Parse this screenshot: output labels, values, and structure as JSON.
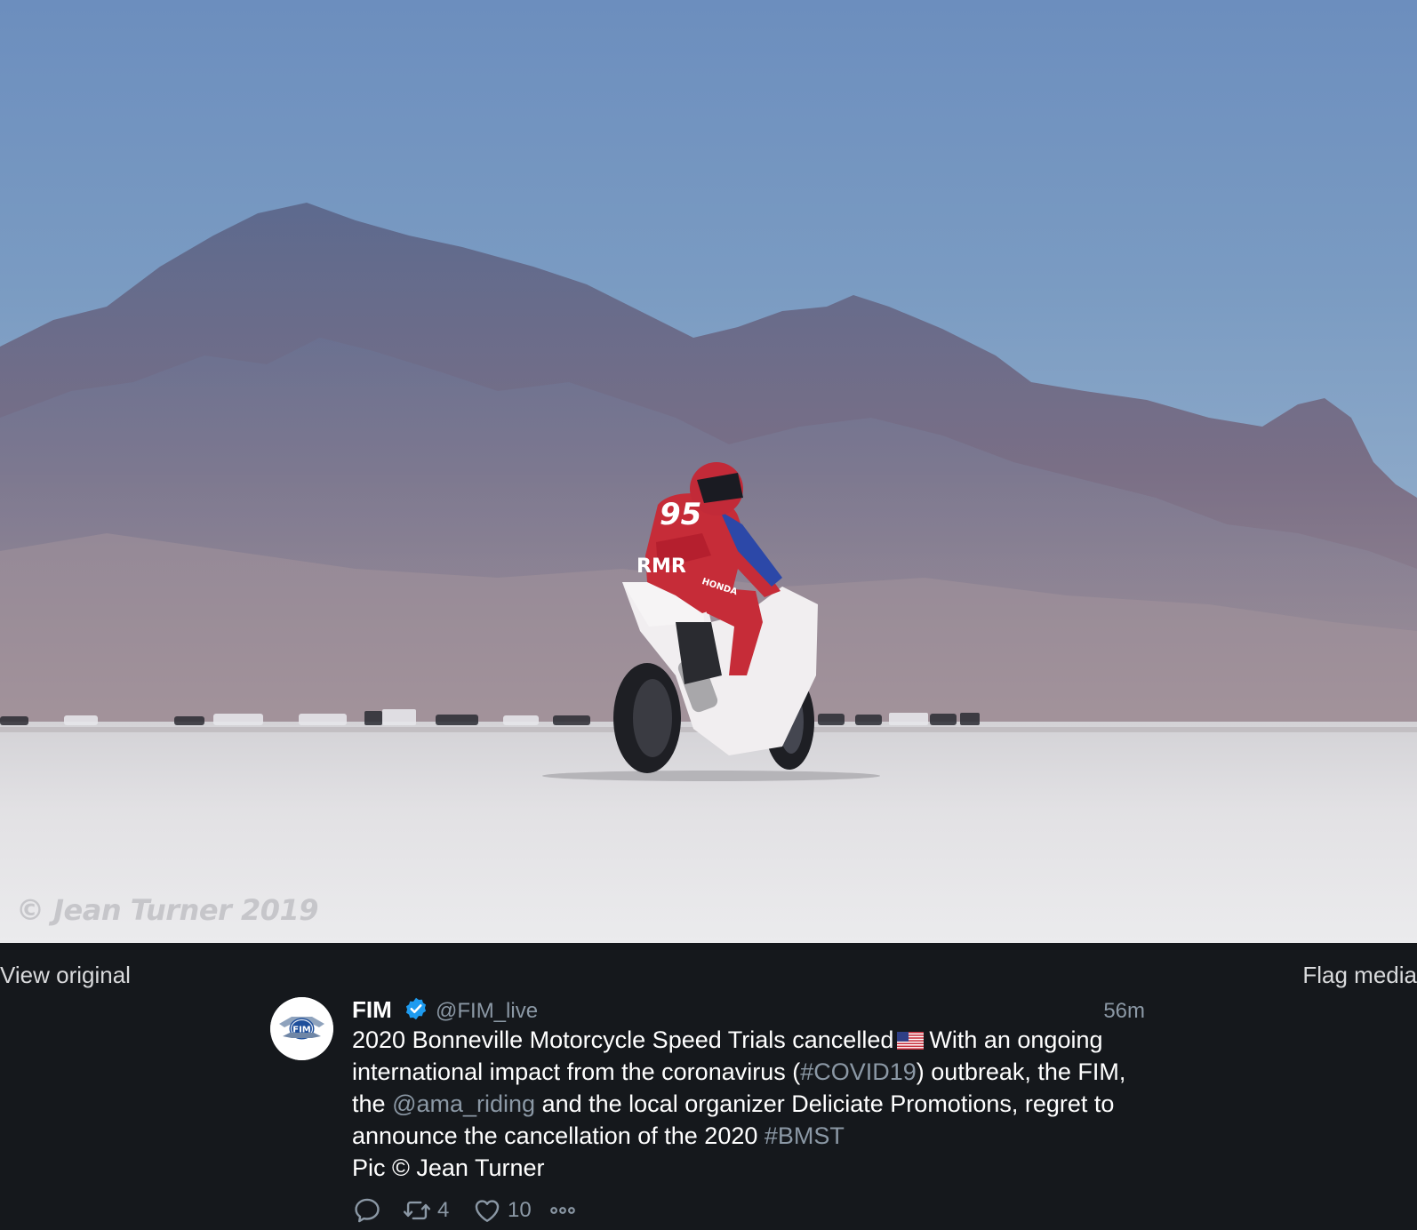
{
  "media": {
    "watermark": "© Jean Turner 2019",
    "rider_number": "95",
    "rider_badge": "RMR",
    "team_logo": "HONDA"
  },
  "viewer": {
    "view_original_label": "View original",
    "flag_media_label": "Flag media"
  },
  "tweet": {
    "author_name": "FIM",
    "author_handle": "@FIM_live",
    "timestamp": "56m",
    "avatar_text": "FIM",
    "text_parts": {
      "p1": "2020 Bonneville Motorcycle Speed Trials cancelled",
      "p2": "With an ongoing international impact from the coronavirus (",
      "hashtag_covid": "#COVID19",
      "p3": ") outbreak, the FIM, the",
      "mention_ama": "@ama_riding",
      "p4": "and the local organizer Deliciate Promotions, regret to announce the cancellation of the 2020",
      "hashtag_bmst": "#BMST",
      "p5": "Pic © Jean Turner"
    },
    "retweet_count": "4",
    "like_count": "10"
  },
  "colors": {
    "page_background": "#15181c",
    "secondary_text": "#8b98a5",
    "verified_badge": "#1d9bf0"
  },
  "icons": [
    "verified-badge-icon",
    "us-flag-icon",
    "reply-icon",
    "retweet-icon",
    "like-icon",
    "more-icon"
  ]
}
